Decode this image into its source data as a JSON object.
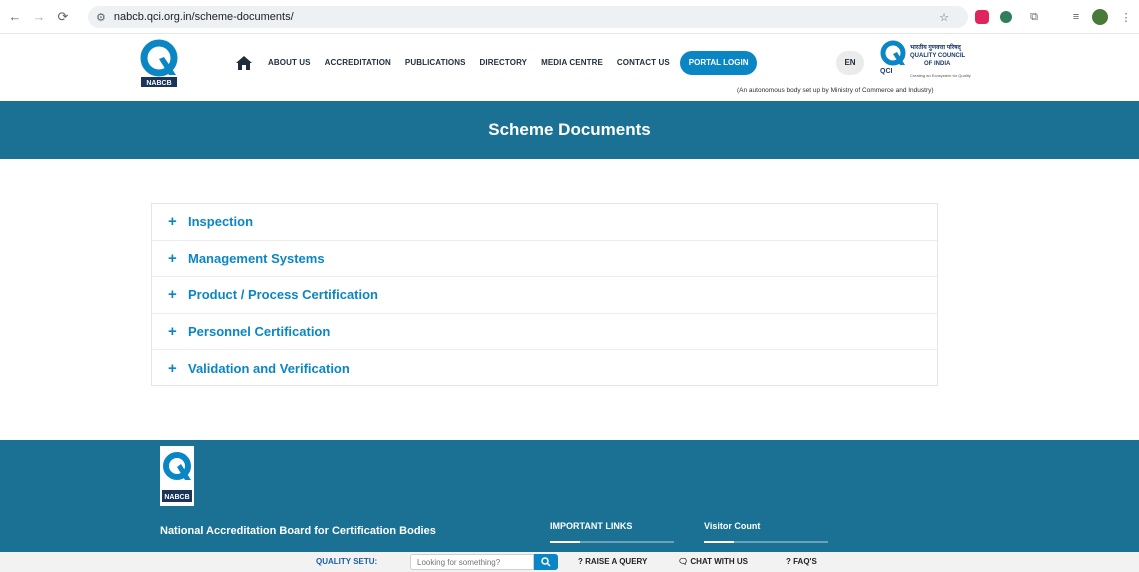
{
  "browser": {
    "url": "nabcb.qci.org.in/scheme-documents/"
  },
  "header": {
    "logo_text": "NABCB",
    "menu": [
      {
        "label": "ABOUT US"
      },
      {
        "label": "ACCREDITATION"
      },
      {
        "label": "PUBLICATIONS"
      },
      {
        "label": "DIRECTORY"
      },
      {
        "label": "MEDIA CENTRE"
      },
      {
        "label": "CONTACT US"
      }
    ],
    "portal_login": "PORTAL LOGIN",
    "language": "EN",
    "qci": {
      "hindi": "भारतीय गुणवत्ता परिषद्",
      "line1": "QUALITY COUNCIL",
      "line2": "OF INDIA",
      "abbr": "QCI",
      "sub": "Creating an Ecosystem for Quality"
    },
    "tagline": "(An autonomous body set up by Ministry of Commerce and Industry)"
  },
  "banner": {
    "title": "Scheme Documents"
  },
  "accordion": {
    "items": [
      {
        "label": "Inspection"
      },
      {
        "label": "Management Systems"
      },
      {
        "label": "Product / Process Certification"
      },
      {
        "label": "Personnel Certification"
      },
      {
        "label": "Validation and Verification"
      }
    ],
    "expand_symbol": "+"
  },
  "footer": {
    "logo_text": "NABCB",
    "org_name": "National Accreditation Board for Certification Bodies",
    "important_links": "IMPORTANT LINKS",
    "visitor_count": "Visitor Count"
  },
  "bottom_bar": {
    "quality_setu": "QUALITY SETU:",
    "search_placeholder": "Looking for something?",
    "raise_query": "? RAISE A QUERY",
    "chat": "CHAT WITH US",
    "faqs": "? FAQ'S"
  },
  "colors": {
    "brand_blue": "#0b86c5",
    "banner_teal": "#1a7194",
    "nav_text": "#1f2d3d"
  }
}
